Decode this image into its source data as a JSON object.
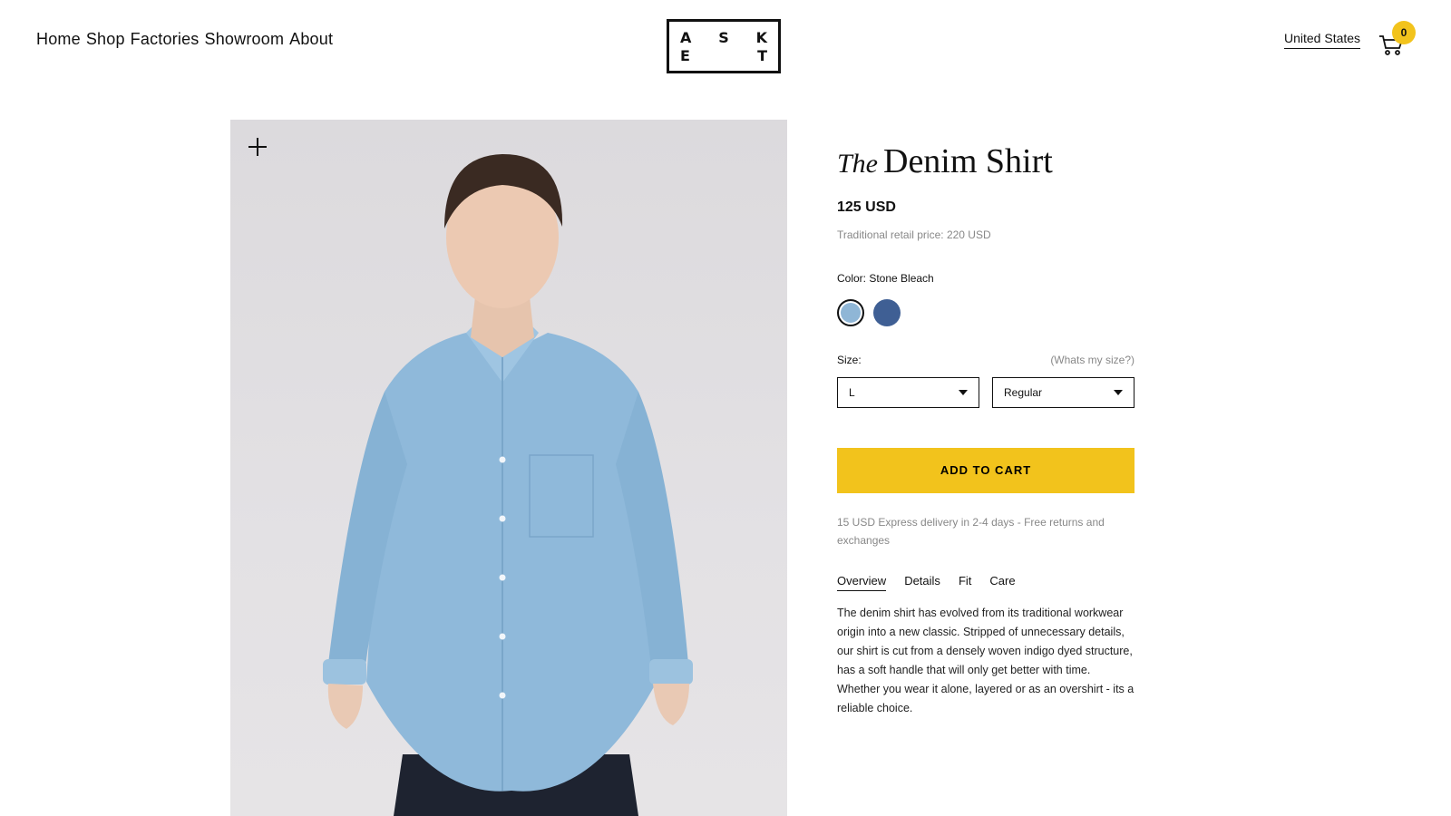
{
  "nav": {
    "items": [
      "Home",
      "Shop",
      "Factories",
      "Showroom",
      "About"
    ]
  },
  "logo": {
    "letters": [
      "A",
      "S",
      "K",
      "E",
      "T"
    ]
  },
  "header": {
    "region": "United States",
    "cart_count": "0"
  },
  "product": {
    "title_prefix": "The",
    "title": "Denim Shirt",
    "price": "125 USD",
    "retail": "Traditional retail price: 220 USD",
    "color_label": "Color: Stone Bleach",
    "swatches": [
      "Stone Bleach",
      "Dark"
    ],
    "size_label": "Size:",
    "size_help": "(Whats my size?)",
    "size_value": "L",
    "fit_value": "Regular",
    "add_to_cart": "ADD TO CART",
    "delivery": "15 USD Express delivery in 2-4 days - Free returns and exchanges",
    "tabs": [
      "Overview",
      "Details",
      "Fit",
      "Care"
    ],
    "active_tab": "Overview",
    "description": "The denim shirt has evolved from its traditional workwear origin into a new classic. Stripped of unnecessary details, our shirt is cut from a densely woven indigo dyed structure, has a soft handle that will only get better with time. Whether you wear it alone, layered or as an overshirt - its a reliable choice."
  },
  "colors": {
    "accent": "#f2c31c",
    "swatch_light": "#8fb6d6",
    "swatch_dark": "#3f5f94"
  }
}
